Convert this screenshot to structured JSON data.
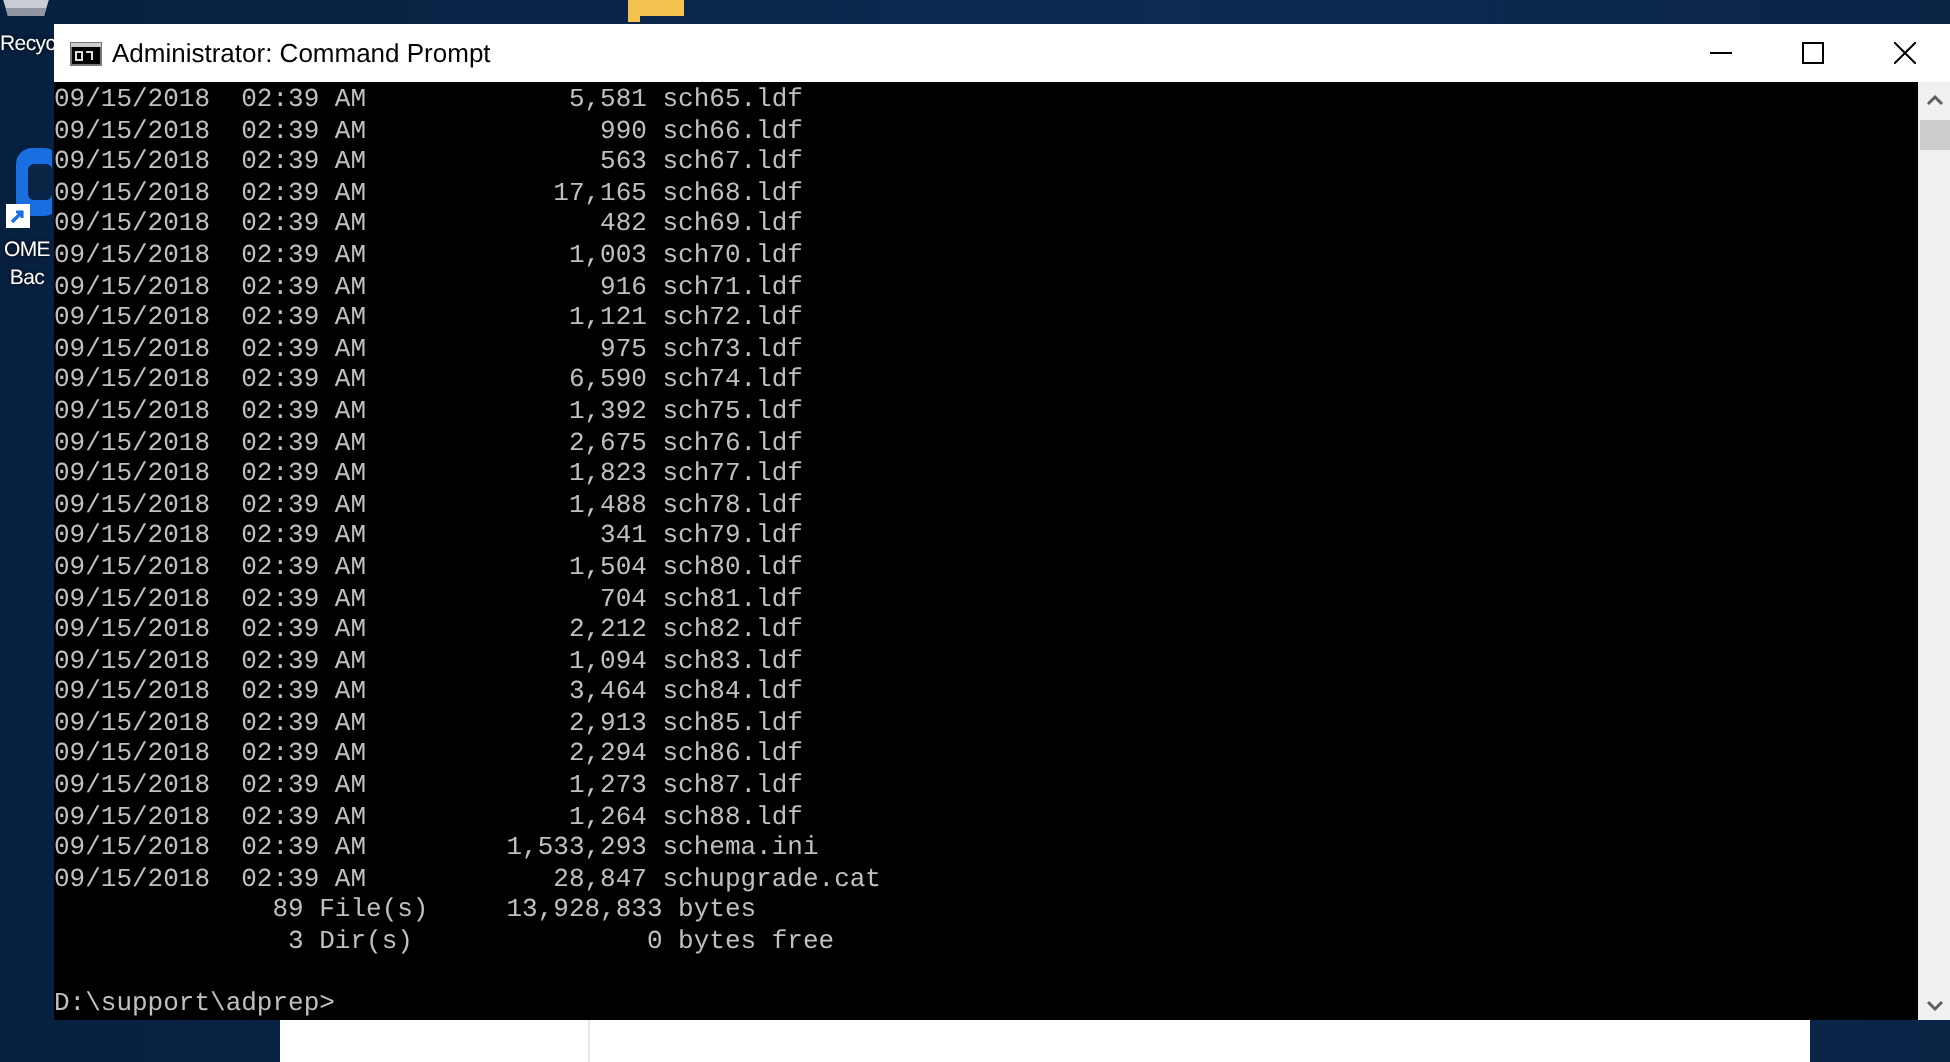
{
  "desktop_icons": [
    {
      "kind": "recycle",
      "labels": [
        "Recyc"
      ]
    },
    {
      "kind": "shortcut",
      "labels": [
        "OME",
        "Bac"
      ]
    },
    {
      "kind": "folder"
    }
  ],
  "window": {
    "title": "Administrator: Command Prompt"
  },
  "console": {
    "lines": [
      "09/15/2018  02:39 AM             5,581 sch65.ldf",
      "09/15/2018  02:39 AM               990 sch66.ldf",
      "09/15/2018  02:39 AM               563 sch67.ldf",
      "09/15/2018  02:39 AM            17,165 sch68.ldf",
      "09/15/2018  02:39 AM               482 sch69.ldf",
      "09/15/2018  02:39 AM             1,003 sch70.ldf",
      "09/15/2018  02:39 AM               916 sch71.ldf",
      "09/15/2018  02:39 AM             1,121 sch72.ldf",
      "09/15/2018  02:39 AM               975 sch73.ldf",
      "09/15/2018  02:39 AM             6,590 sch74.ldf",
      "09/15/2018  02:39 AM             1,392 sch75.ldf",
      "09/15/2018  02:39 AM             2,675 sch76.ldf",
      "09/15/2018  02:39 AM             1,823 sch77.ldf",
      "09/15/2018  02:39 AM             1,488 sch78.ldf",
      "09/15/2018  02:39 AM               341 sch79.ldf",
      "09/15/2018  02:39 AM             1,504 sch80.ldf",
      "09/15/2018  02:39 AM               704 sch81.ldf",
      "09/15/2018  02:39 AM             2,212 sch82.ldf",
      "09/15/2018  02:39 AM             1,094 sch83.ldf",
      "09/15/2018  02:39 AM             3,464 sch84.ldf",
      "09/15/2018  02:39 AM             2,913 sch85.ldf",
      "09/15/2018  02:39 AM             2,294 sch86.ldf",
      "09/15/2018  02:39 AM             1,273 sch87.ldf",
      "09/15/2018  02:39 AM             1,264 sch88.ldf",
      "09/15/2018  02:39 AM         1,533,293 schema.ini",
      "09/15/2018  02:39 AM            28,847 schupgrade.cat",
      "              89 File(s)     13,928,833 bytes",
      "               3 Dir(s)               0 bytes free"
    ],
    "prompt": "D:\\support\\adprep>"
  }
}
